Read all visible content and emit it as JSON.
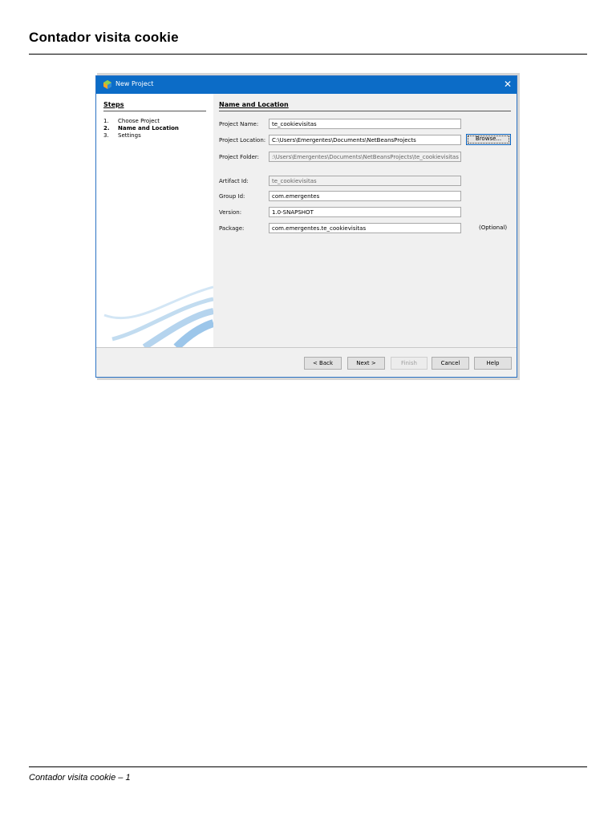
{
  "document": {
    "title": "Contador visita cookie",
    "footer": "Contador visita cookie – 1"
  },
  "dialog": {
    "title": "New Project",
    "close_label": "✕",
    "steps_heading": "Steps",
    "steps": [
      {
        "num": "1.",
        "label": "Choose Project",
        "current": false
      },
      {
        "num": "2.",
        "label": "Name and Location",
        "current": true
      },
      {
        "num": "3.",
        "label": "Settings",
        "current": false
      }
    ],
    "section_heading": "Name and Location",
    "fields": {
      "project_name": {
        "label": "Project Name:",
        "value": "te_cookievisitas"
      },
      "project_location": {
        "label": "Project Location:",
        "value": "C:\\Users\\Emergentes\\Documents\\NetBeansProjects"
      },
      "project_folder": {
        "label": "Project Folder:",
        "value": ":\\Users\\Emergentes\\Documents\\NetBeansProjects\\te_cookievisitas"
      },
      "artifact_id": {
        "label": "Artifact Id:",
        "value": "te_cookievisitas"
      },
      "group_id": {
        "label": "Group Id:",
        "value": "com.emergentes"
      },
      "version": {
        "label": "Version:",
        "value": "1.0-SNAPSHOT"
      },
      "package": {
        "label": "Package:",
        "value": "com.emergentes.te_cookievisitas"
      }
    },
    "browse_label": "Browse...",
    "optional_label": "(Optional)",
    "buttons": {
      "back": "< Back",
      "next": "Next >",
      "finish": "Finish",
      "cancel": "Cancel",
      "help": "Help"
    },
    "colors": {
      "titlebar": "#0c6cc7",
      "accent": "#0a64c0"
    }
  }
}
